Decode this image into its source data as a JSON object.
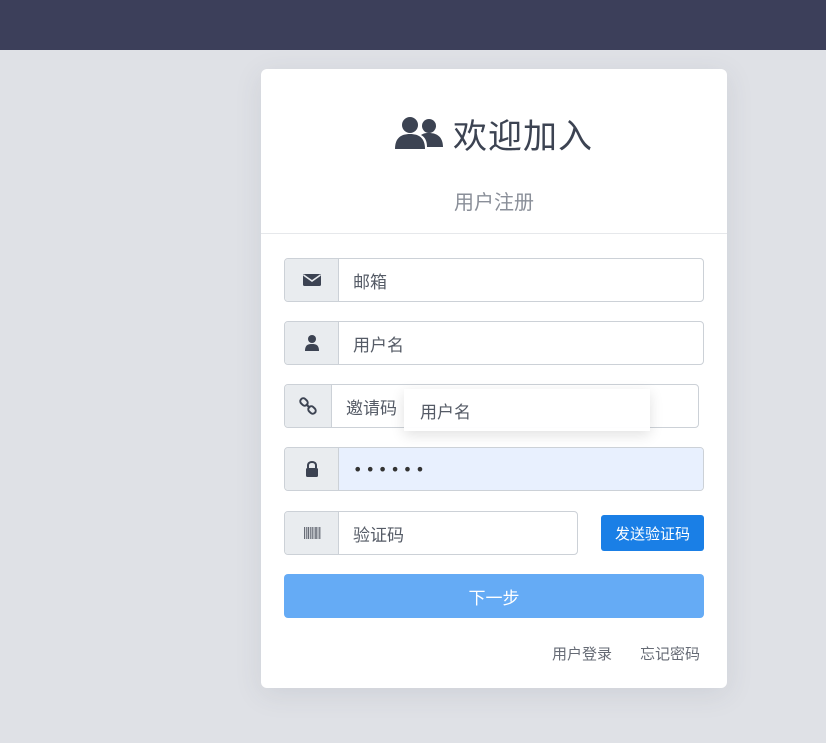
{
  "header": {
    "background": "#3c3f5a"
  },
  "card": {
    "title": "欢迎加入",
    "title_icon": "users-icon",
    "subtitle": "用户注册"
  },
  "form": {
    "email": {
      "icon": "envelope-icon",
      "placeholder": "邮箱"
    },
    "username": {
      "icon": "user-icon",
      "placeholder": "用户名"
    },
    "invite_code": {
      "icon": "link-icon",
      "placeholder": "邀请码"
    },
    "password": {
      "icon": "lock-icon",
      "value": "••••••"
    },
    "verify_code": {
      "icon": "barcode-icon",
      "placeholder": "验证码"
    },
    "send_code_label": "发送验证码",
    "next_label": "下一步"
  },
  "autocomplete": {
    "suggestion": "用户名"
  },
  "links": {
    "login": "用户登录",
    "forgot_password": "忘记密码"
  },
  "colors": {
    "primary": "#1a7fe6",
    "next_button": "#65abf5",
    "autofill": "#e8f0fe"
  }
}
